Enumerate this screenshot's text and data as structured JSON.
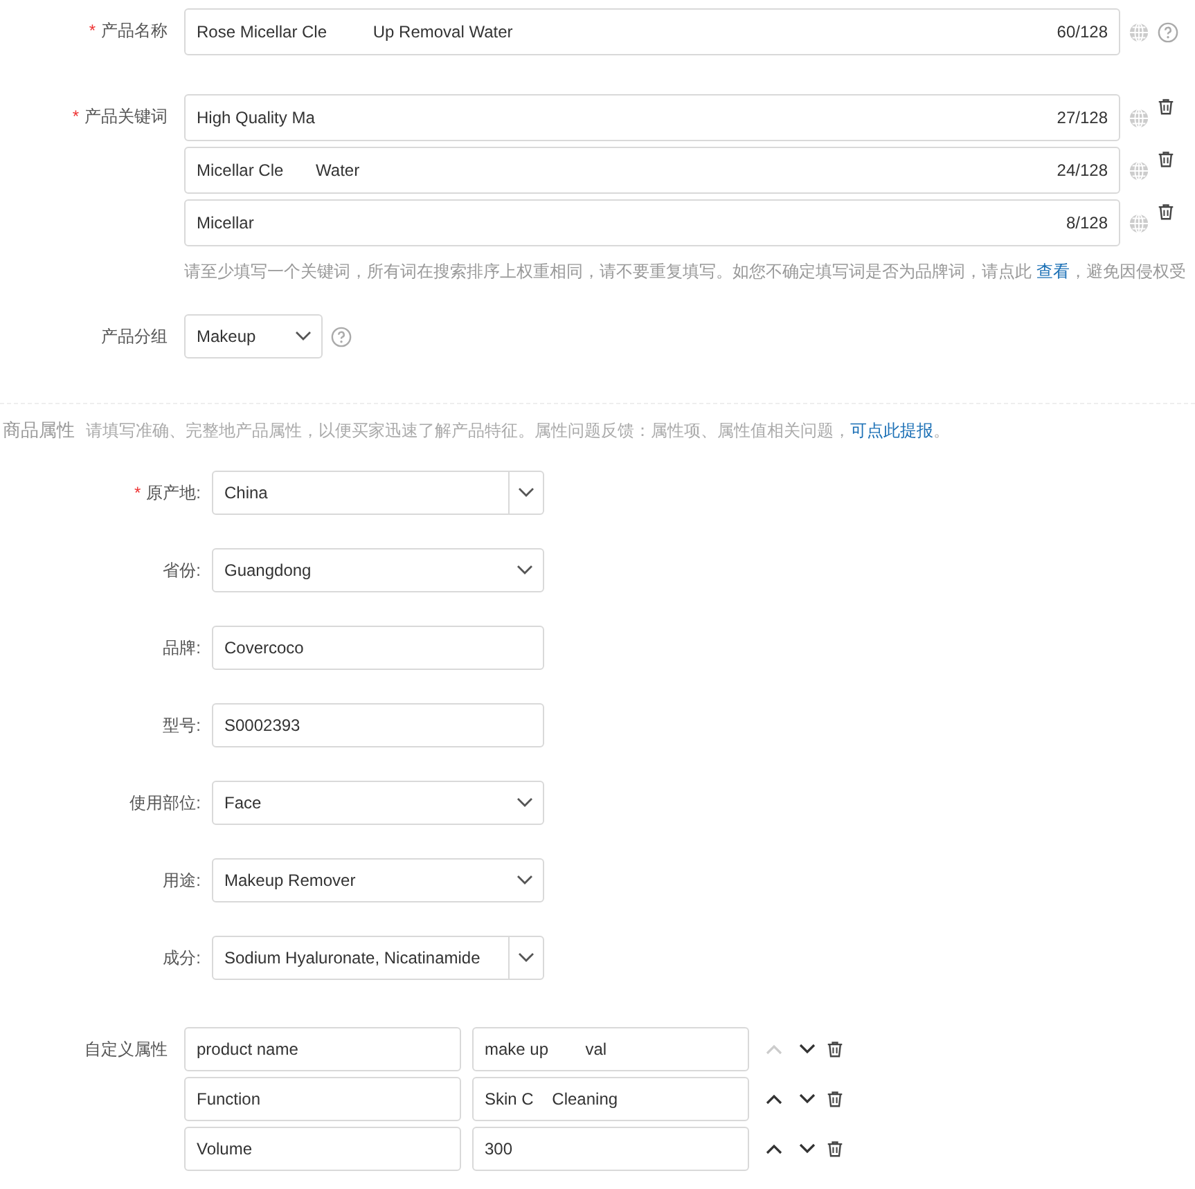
{
  "product_name": {
    "label": "产品名称",
    "required_mark": "*",
    "value": "Rose Micellar Cle          Up Removal Water",
    "count": "60/128"
  },
  "keywords": {
    "label": "产品关键词",
    "required_mark": "*",
    "items": [
      {
        "value": "High Quality Ma",
        "count": "27/128"
      },
      {
        "value": "Micellar Cle       Water",
        "count": "24/128"
      },
      {
        "value": "Micellar",
        "count": "8/128"
      }
    ],
    "hint": "请至少填写一个关键词，所有词在搜索排序上权重相同，请不要重复填写。如您不确定填写词是否为品牌词，请点此",
    "hint_link": "查看",
    "hint_tail": "，避免因侵权受"
  },
  "group": {
    "label": "产品分组",
    "value": "Makeup"
  },
  "attributes_section": {
    "title": "商品属性",
    "note": "请填写准确、完整地产品属性，以便买家迅速了解产品特征。属性问题反馈：属性项、属性值相关问题，",
    "link": "可点此提报",
    "tail": "。"
  },
  "attributes": [
    {
      "label": "原产地:",
      "required_mark": "*",
      "kind": "combo",
      "value": "China"
    },
    {
      "label": "省份:",
      "kind": "select",
      "value": "Guangdong"
    },
    {
      "label": "品牌:",
      "kind": "input",
      "value": "Covercoco"
    },
    {
      "label": "型号:",
      "kind": "input",
      "value": "S0002393"
    },
    {
      "label": "使用部位:",
      "kind": "select",
      "value": "Face"
    },
    {
      "label": "用途:",
      "kind": "select",
      "value": "Makeup Remover"
    },
    {
      "label": "成分:",
      "kind": "combo",
      "value": "Sodium Hyaluronate, Nicatinamide"
    }
  ],
  "custom": {
    "label": "自定义属性",
    "rows": [
      {
        "name": "product name",
        "value": "make up        val",
        "up_disabled": true
      },
      {
        "name": "Function",
        "value": "Skin C    Cleaning",
        "up_disabled": false
      },
      {
        "name": "Volume",
        "value": "300",
        "up_disabled": false
      }
    ]
  }
}
